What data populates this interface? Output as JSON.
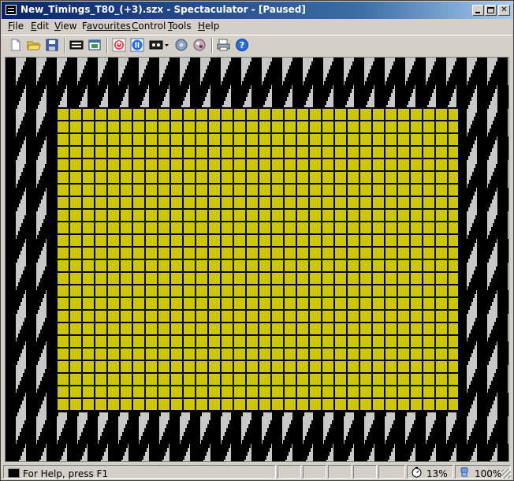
{
  "window": {
    "title": "New_Timings_T80_(+3).szx - Spectaculator - [Paused]"
  },
  "menu": [
    {
      "key": "F",
      "rest": "ile"
    },
    {
      "key": "E",
      "rest": "dit"
    },
    {
      "key": "V",
      "rest": "iew"
    },
    {
      "key": "F",
      "rest": "avourites",
      "prefix": ""
    },
    {
      "key": "C",
      "rest": "ontrol"
    },
    {
      "key": "T",
      "rest": "ools"
    },
    {
      "key": "H",
      "rest": "elp"
    }
  ],
  "toolbar": {
    "icons": [
      "new-file-icon",
      "open-folder-icon",
      "save-icon",
      "keyboard-icon",
      "window-icon",
      "power-reset-icon",
      "pause-icon",
      "tape-icon",
      "disk-icon",
      "dial-icon",
      "printer-icon",
      "help-icon"
    ]
  },
  "screen": {
    "paper_color": "#cdc700",
    "ink_color": "#000000",
    "border_colors": [
      "#000000",
      "#c8c8c8"
    ]
  },
  "status": {
    "help_text": "For Help, press F1",
    "speed": "13%",
    "volume": "100%"
  },
  "colors": {
    "titlebar_start": "#0a246a",
    "titlebar_end": "#a6caf0",
    "chrome": "#d4d0c8"
  }
}
